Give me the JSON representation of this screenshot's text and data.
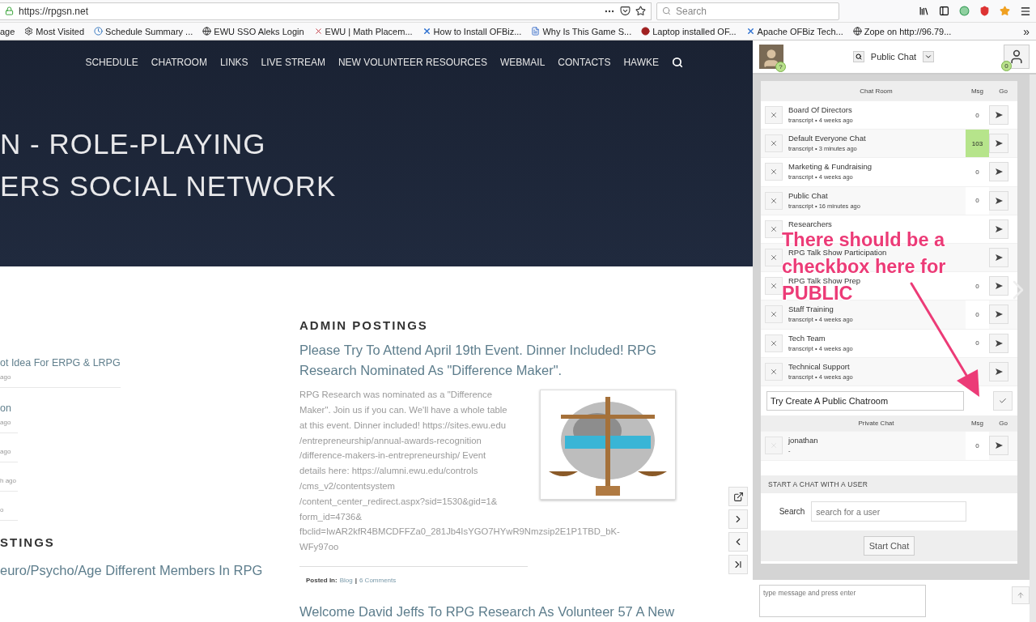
{
  "browser": {
    "url": "https://rpgsn.net",
    "search_placeholder": "Search",
    "bookmarks": [
      {
        "kind": "plain",
        "label": "age"
      },
      {
        "kind": "gear",
        "label": "Most Visited"
      },
      {
        "kind": "clock",
        "label": "Schedule Summary ..."
      },
      {
        "kind": "globe",
        "label": "EWU SSO Aleks Login"
      },
      {
        "kind": "mark",
        "label": "EWU | Math Placem..."
      },
      {
        "kind": "cross",
        "label": "How to Install OFBiz..."
      },
      {
        "kind": "doc",
        "label": "Why Is This Game S..."
      },
      {
        "kind": "dot",
        "label": "Laptop installed OF..."
      },
      {
        "kind": "cross",
        "label": "Apache OFBiz Tech..."
      },
      {
        "kind": "globe",
        "label": "Zope on http://96.79..."
      }
    ],
    "overflow": "»"
  },
  "site": {
    "nav": [
      "SCHEDULE",
      "CHATROOM",
      "LINKS",
      "LIVE STREAM",
      "NEW VOLUNTEER RESOURCES",
      "WEBMAIL",
      "CONTACTS",
      "HAWKE"
    ],
    "hero_lines": [
      "N - ROLE-PLAYING",
      "ERS SOCIAL NETWORK"
    ],
    "left_items": [
      {
        "title": "ot Idea For ERPG & LRPG",
        "time": "ago"
      },
      {
        "title": "on",
        "time": "ago"
      },
      {
        "time": "ago"
      },
      {
        "time": "h ago"
      },
      {
        "time": "o"
      }
    ],
    "left_heading": "STINGS",
    "left_post_title": "euro/Psycho/Age Different Members In RPG",
    "admin_heading": "ADMIN POSTINGS",
    "post": {
      "title": "Please Try To Attend April 19th Event. Dinner Included! RPG Research Nominated As \"Difference Maker\".",
      "body": "RPG Research was nominated as a \"Difference\nMaker\". Join us if you can. We'll have a whole table\nat this event. Dinner included! https://sites.ewu.edu\n/entrepreneurship/annual-awards-recognition\n/difference-makers-in-entrepreneurship/ Event\ndetails here: https://alumni.ewu.edu/controls\n/cms_v2/contentsystem\n/content_center_redirect.aspx?sid=1530&gid=1&\nform_id=4736&",
      "body_continued": "fbclid=IwAR2kfR4BMCDFFZa0_281Jb4IsYGO7HYwR9Nmzsip2E1P1TBD_bK-\nWFy97oo",
      "posted_in": "Posted In:",
      "category": "Blog",
      "separator": "|",
      "comments": "6 Comments"
    },
    "next_post_title": "Welcome David Jeffs To RPG Research As Volunteer 57 A New"
  },
  "chat": {
    "avatar_badge": "?",
    "room_select": "Public Chat",
    "user_badge": "0",
    "rooms_header": {
      "name": "Chat Room",
      "msg": "Msg",
      "go": "Go"
    },
    "rooms": [
      {
        "name": "Board Of Directors",
        "sub": "transcript • 4 weeks ago",
        "msg": "0",
        "highlight": false
      },
      {
        "name": "Default Everyone Chat",
        "sub": "transcript • 3 minutes ago",
        "msg": "103",
        "highlight": true
      },
      {
        "name": "Marketing & Fundraising",
        "sub": "transcript • 4 weeks ago",
        "msg": "0",
        "highlight": false
      },
      {
        "name": "Public Chat",
        "sub": "transcript • 16 minutes ago",
        "msg": "0",
        "highlight": false
      },
      {
        "name": "Researchers"
      },
      {
        "name": "RPG Talk Show Participation"
      },
      {
        "name": "RPG Talk Show Prep",
        "msg": "0",
        "highlight": false
      },
      {
        "name": "Staff Training",
        "sub": "transcript • 4 weeks ago",
        "msg": "0",
        "highlight": false
      },
      {
        "name": "Tech Team",
        "sub": "transcript • 4 weeks ago",
        "msg": "0",
        "highlight": false
      },
      {
        "name": "Technical Support",
        "sub": "transcript • 4 weeks ago"
      }
    ],
    "new_room_value": "Try Create A Public Chatroom",
    "private_header": {
      "name": "Private Chat",
      "msg": "Msg",
      "go": "Go"
    },
    "private": [
      {
        "name": "jonathan",
        "sub": "-",
        "msg": "0",
        "disabled": true
      }
    ],
    "start_heading": "START A CHAT WITH A USER",
    "search_label": "Search",
    "search_placeholder": "search for a user",
    "start_button": "Start Chat",
    "message_placeholder": "type message and press enter"
  },
  "annotation": {
    "lines": [
      "There should be a",
      "checkbox here for",
      "PUBLIC"
    ]
  }
}
